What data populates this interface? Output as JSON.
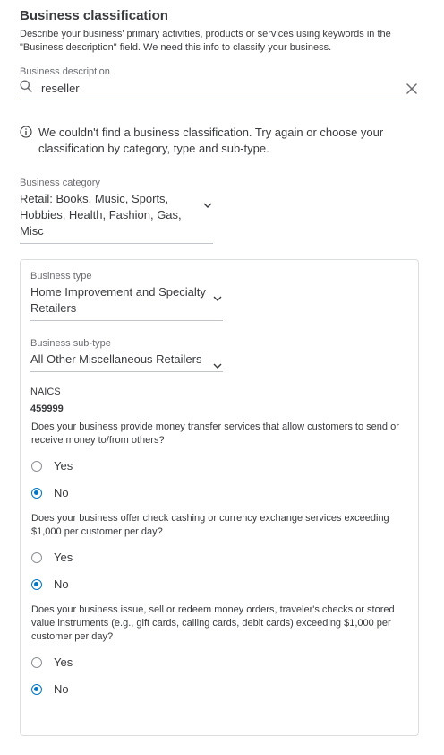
{
  "section": {
    "title": "Business classification",
    "subtitle": "Describe your business' primary activities, products or services using keywords in the \"Business description\" field. We need this info to classify your business."
  },
  "description": {
    "label": "Business description",
    "value": "reseller",
    "search_icon": "search-icon",
    "clear_icon": "close-icon"
  },
  "notice": {
    "icon": "info-icon",
    "text": "We couldn't find a business classification. Try again or choose your classification by category, type and sub-type."
  },
  "category": {
    "label": "Business category",
    "value_lines": [
      "Retail: Books, Music, Sports,",
      "Hobbies, Health, Fashion, Gas,",
      "Misc"
    ]
  },
  "type": {
    "label": "Business type",
    "value_lines": [
      "Home Improvement and Specialty",
      "Retailers"
    ]
  },
  "subtype": {
    "label": "Business sub-type",
    "value": "All Other Miscellaneous Retailers"
  },
  "naics": {
    "label": "NAICS",
    "value": "459999"
  },
  "questions": [
    {
      "text": "Does your business provide money transfer services that allow customers to send or receive money to/from others?",
      "options": [
        {
          "label": "Yes",
          "checked": false
        },
        {
          "label": "No",
          "checked": true
        }
      ]
    },
    {
      "text": "Does your business offer check cashing or currency exchange services exceeding $1,000 per customer per day?",
      "options": [
        {
          "label": "Yes",
          "checked": false
        },
        {
          "label": "No",
          "checked": true
        }
      ]
    },
    {
      "text": "Does your business issue, sell or redeem money orders, traveler's checks or stored value instruments (e.g., gift cards, calling cards, debit cards) exceeding $1,000 per customer per day?",
      "options": [
        {
          "label": "Yes",
          "checked": false
        },
        {
          "label": "No",
          "checked": true
        }
      ]
    }
  ],
  "colors": {
    "accent": "#0077c5",
    "text": "#393a3d",
    "muted": "#6b6c72",
    "border": "#dcdde0"
  }
}
